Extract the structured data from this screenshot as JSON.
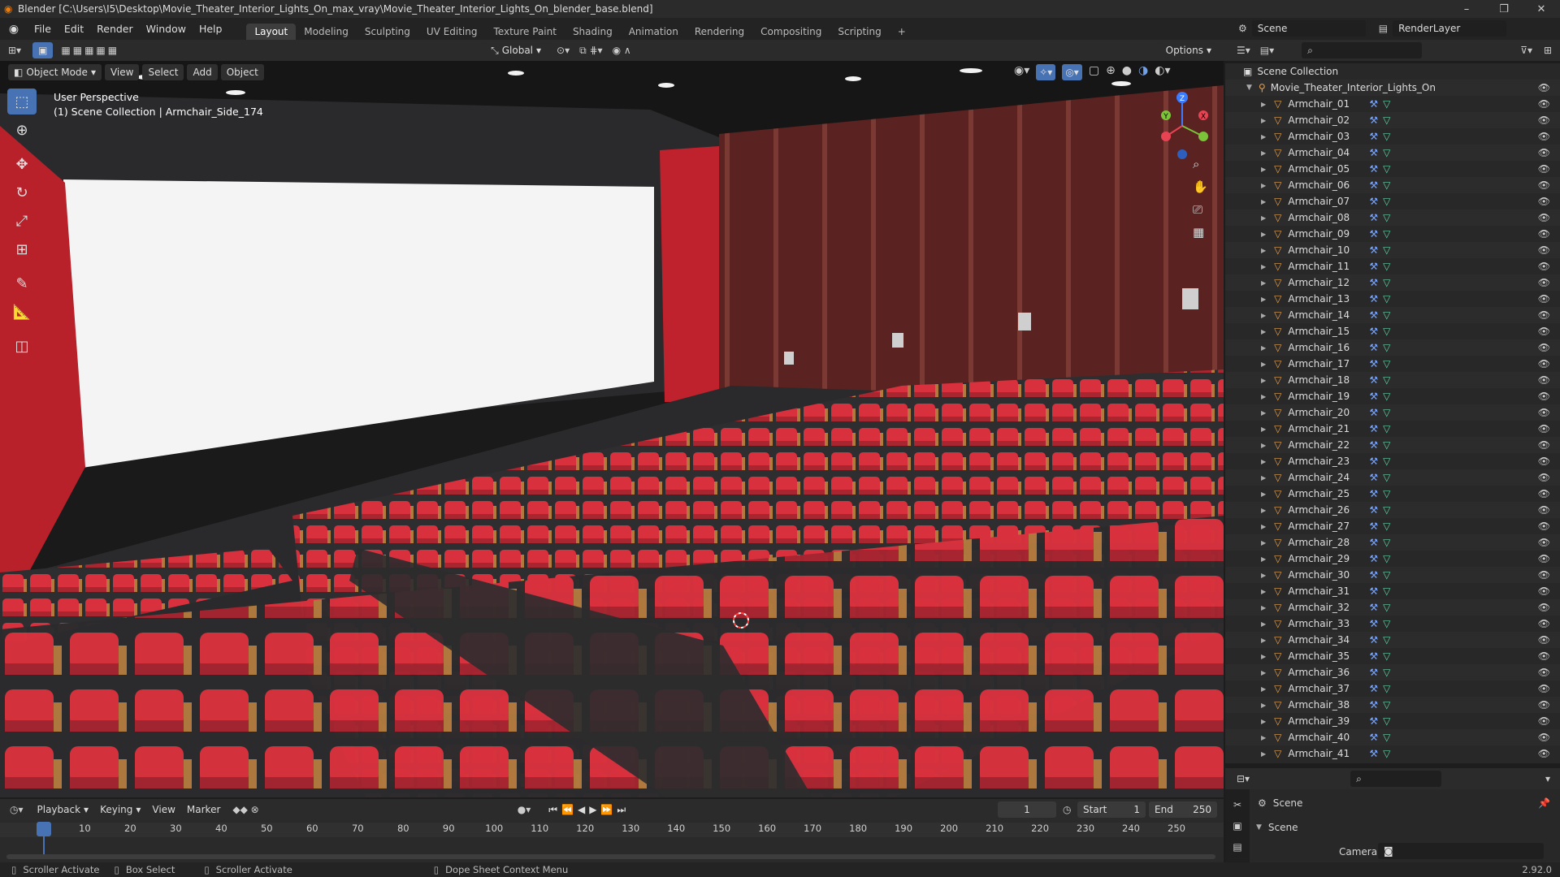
{
  "window": {
    "title": "Blender [C:\\Users\\I5\\Desktop\\Movie_Theater_Interior_Lights_On_max_vray\\Movie_Theater_Interior_Lights_On_blender_base.blend]",
    "controls": [
      "–",
      "❐",
      "✕"
    ]
  },
  "menu": [
    "File",
    "Edit",
    "Render",
    "Window",
    "Help"
  ],
  "workspaces": [
    "Layout",
    "Modeling",
    "Sculpting",
    "UV Editing",
    "Texture Paint",
    "Shading",
    "Animation",
    "Rendering",
    "Compositing",
    "Scripting"
  ],
  "active_workspace": "Layout",
  "top_right": {
    "scene": "Scene",
    "view_layer": "RenderLayer"
  },
  "viewport_header": {
    "orientation": "Global",
    "options": "Options",
    "mode": "Object Mode",
    "menus": [
      "View",
      "Select",
      "Add",
      "Object"
    ]
  },
  "viewport": {
    "line1": "User Perspective",
    "line2": "(1) Scene Collection | Armchair_Side_174"
  },
  "gizmo": {
    "x": "X",
    "y": "Y",
    "z": "Z"
  },
  "outliner": {
    "root": "Scene Collection",
    "collection": "Movie_Theater_Interior_Lights_On",
    "items": [
      "Armchair_01",
      "Armchair_02",
      "Armchair_03",
      "Armchair_04",
      "Armchair_05",
      "Armchair_06",
      "Armchair_07",
      "Armchair_08",
      "Armchair_09",
      "Armchair_10",
      "Armchair_11",
      "Armchair_12",
      "Armchair_13",
      "Armchair_14",
      "Armchair_15",
      "Armchair_16",
      "Armchair_17",
      "Armchair_18",
      "Armchair_19",
      "Armchair_20",
      "Armchair_21",
      "Armchair_22",
      "Armchair_23",
      "Armchair_24",
      "Armchair_25",
      "Armchair_26",
      "Armchair_27",
      "Armchair_28",
      "Armchair_29",
      "Armchair_30",
      "Armchair_31",
      "Armchair_32",
      "Armchair_33",
      "Armchair_34",
      "Armchair_35",
      "Armchair_36",
      "Armchair_37",
      "Armchair_38",
      "Armchair_39",
      "Armchair_40",
      "Armchair_41"
    ]
  },
  "properties": {
    "context": "Scene",
    "section": "Scene",
    "camera_label": "Camera"
  },
  "timeline": {
    "menus": [
      "Playback",
      "Keying",
      "View",
      "Marker"
    ],
    "current_frame": "1",
    "start_label": "Start",
    "start": "1",
    "end_label": "End",
    "end": "250",
    "ticks": [
      "1",
      "10",
      "20",
      "30",
      "40",
      "50",
      "60",
      "70",
      "80",
      "90",
      "100",
      "110",
      "120",
      "130",
      "140",
      "150",
      "160",
      "170",
      "180",
      "190",
      "200",
      "210",
      "220",
      "230",
      "240",
      "250"
    ]
  },
  "status": {
    "items": [
      "Scroller Activate",
      "Box Select",
      "Scroller Activate",
      "Dope Sheet Context Menu"
    ],
    "version": "2.92.0"
  },
  "colors": {
    "accent": "#4772b3",
    "seat": "#d8313d",
    "wall": "#5a2220"
  }
}
